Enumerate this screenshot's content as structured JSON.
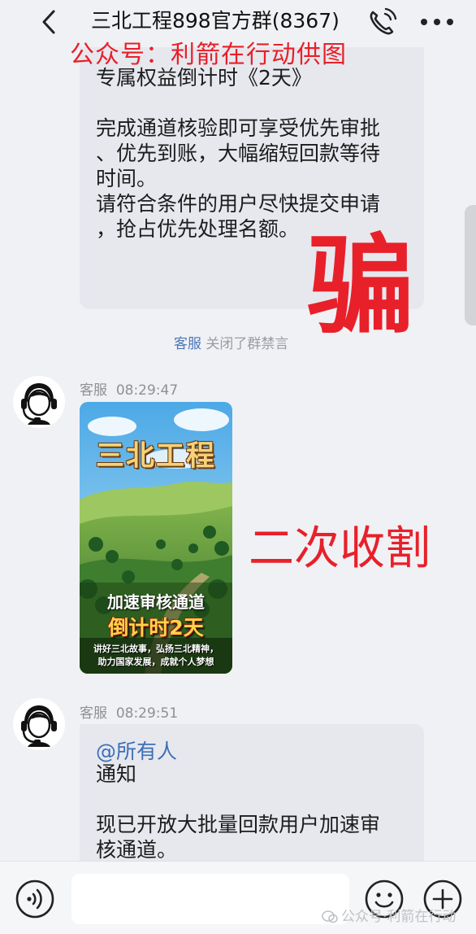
{
  "header": {
    "title": "三北工程898官方群(8367)",
    "icons": [
      "back-icon",
      "phone-icon",
      "more-icon"
    ]
  },
  "watermark_top": "公众号：利箭在行动供图",
  "messages": {
    "bubble1_text": "专属权益倒计时《2天》\n\n完成通道核验即可享受优先审批\n、优先到账，大幅缩短回款等待\n时间。\n请符合条件的用户尽快提交申请\n，抢占优先处理名额。",
    "annotation_pian": "骗",
    "system_notice": {
      "actor": "客服",
      "text": "关闭了群禁言"
    },
    "msg2": {
      "sender": "客服",
      "time": "08:29:47",
      "poster": {
        "title": "三北工程",
        "line1": "加速审核通道",
        "line2": "倒计时2天",
        "line3": "讲好三北故事，弘扬三北精神，\n助力国家发展，成就个人梦想"
      }
    },
    "annotation_second": "二次收割",
    "msg3": {
      "sender": "客服",
      "time": "08:29:51",
      "mention": "@所有人",
      "text": "通知\n\n现已开放大批量回款用户加速审\n核通道。"
    }
  },
  "input_bar": {
    "placeholder": "",
    "icons": [
      "voice-icon",
      "emoji-icon",
      "plus-icon"
    ]
  },
  "watermark_bottom": "公众号·利箭在行动",
  "colors": {
    "background": "#f0f1f4",
    "bubble": "#e6e8ee",
    "annotation_red": "#e8202a",
    "link_blue": "#4b77b8"
  }
}
